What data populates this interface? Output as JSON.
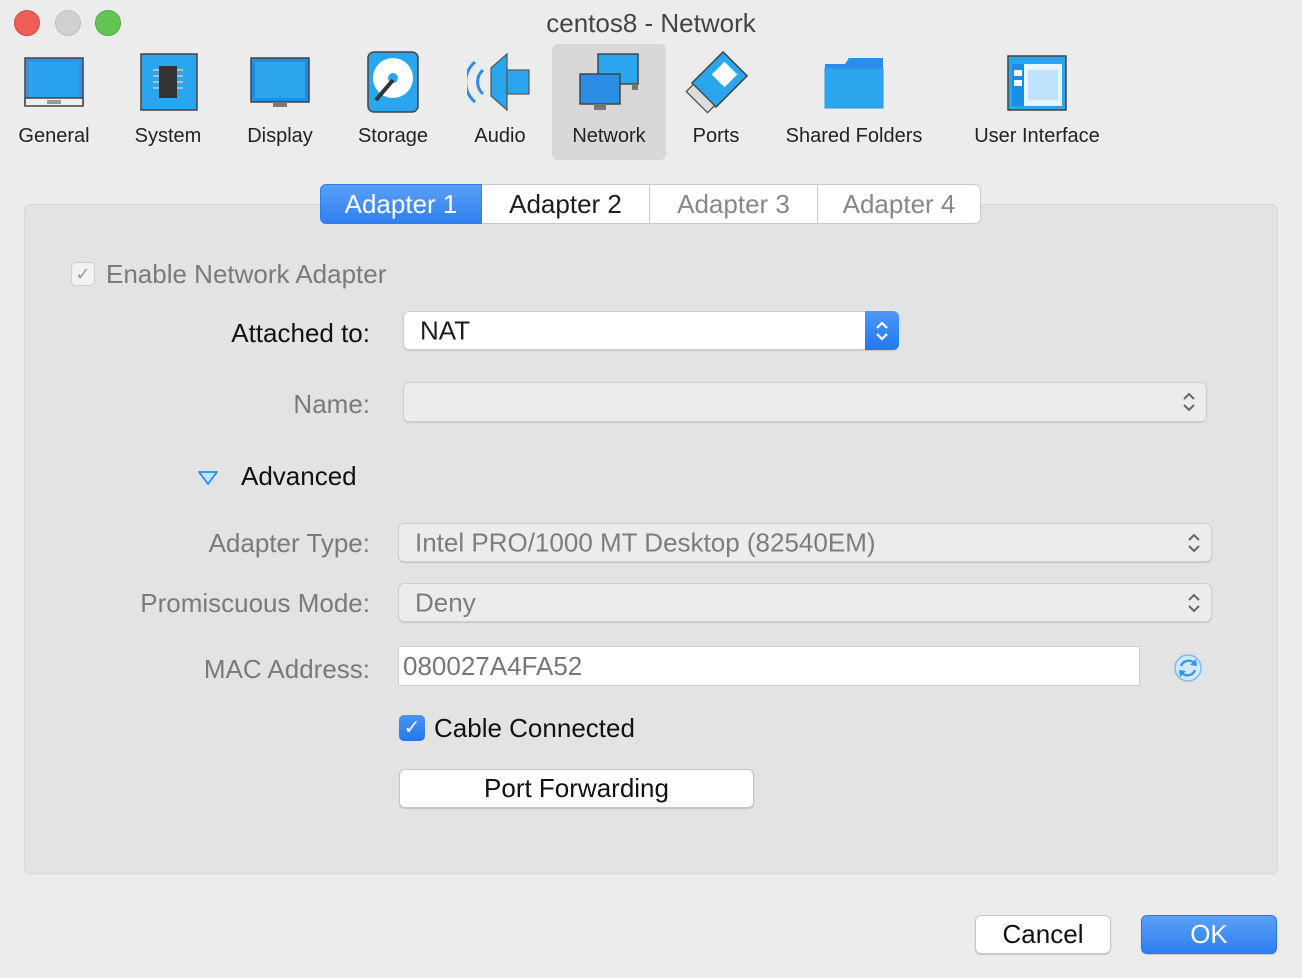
{
  "window": {
    "title": "centos8 - Network"
  },
  "toolbar": {
    "items": [
      {
        "label": "General",
        "icon": "general-icon"
      },
      {
        "label": "System",
        "icon": "system-icon"
      },
      {
        "label": "Display",
        "icon": "display-icon"
      },
      {
        "label": "Storage",
        "icon": "storage-icon"
      },
      {
        "label": "Audio",
        "icon": "audio-icon"
      },
      {
        "label": "Network",
        "icon": "network-icon",
        "selected": true
      },
      {
        "label": "Ports",
        "icon": "ports-icon"
      },
      {
        "label": "Shared Folders",
        "icon": "folder-icon"
      },
      {
        "label": "User Interface",
        "icon": "user-interface-icon"
      }
    ]
  },
  "tabs": [
    {
      "label": "Adapter 1",
      "active": true
    },
    {
      "label": "Adapter 2"
    },
    {
      "label": "Adapter 3"
    },
    {
      "label": "Adapter 4"
    }
  ],
  "form": {
    "enable_adapter": {
      "label": "Enable Network Adapter",
      "checked": true
    },
    "attached_to": {
      "label": "Attached to:",
      "value": "NAT"
    },
    "name": {
      "label": "Name:",
      "value": ""
    },
    "advanced": {
      "label": "Advanced",
      "expanded": true
    },
    "adapter_type": {
      "label": "Adapter Type:",
      "value": "Intel PRO/1000 MT Desktop (82540EM)"
    },
    "promiscuous_mode": {
      "label": "Promiscuous Mode:",
      "value": "Deny"
    },
    "mac_address": {
      "label": "MAC Address:",
      "value": "080027A4FA52"
    },
    "cable_connected": {
      "label": "Cable Connected",
      "checked": true
    },
    "port_forwarding": {
      "label": "Port Forwarding"
    }
  },
  "footer": {
    "cancel_label": "Cancel",
    "ok_label": "OK"
  },
  "colors": {
    "accent": "#2f7ff0",
    "background": "#ececec",
    "panel": "#e3e3e3"
  }
}
